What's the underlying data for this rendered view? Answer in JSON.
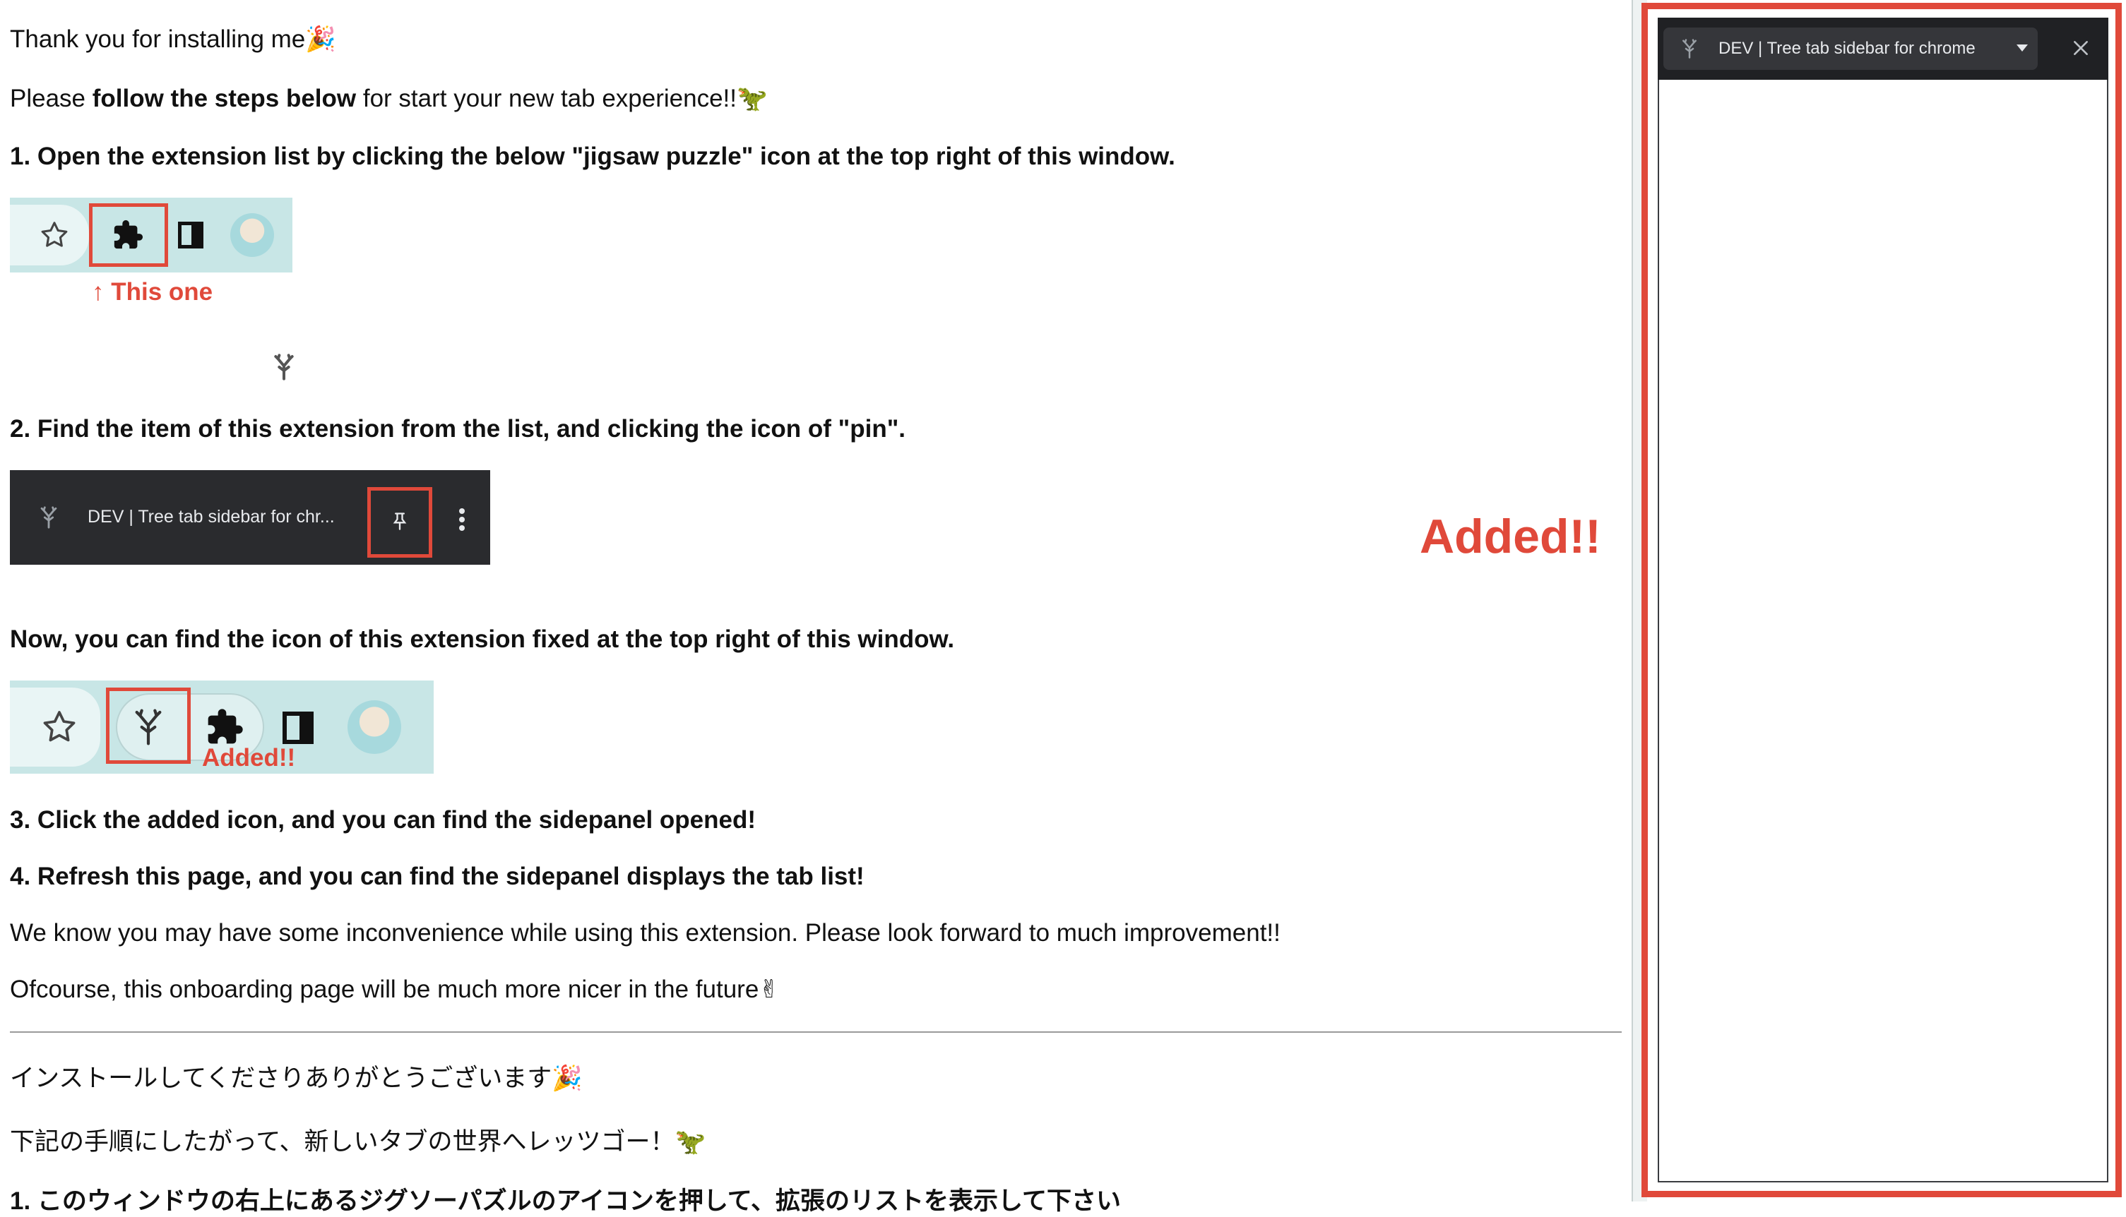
{
  "page": {
    "p_thanks": {
      "text": "Thank you for installing me",
      "emoji": "🎉"
    },
    "p_follow": {
      "pre": "Please ",
      "bold": "follow the steps below",
      "post": " for start your new tab experience!!",
      "emoji": "🦖"
    },
    "step1": "1. Open the extension list by clicking the below \"jigsaw puzzle\" icon at the top right of this window.",
    "this_one": "↑ This one",
    "step2": "2. Find the item of this extension from the list, and clicking the icon of \"pin\".",
    "popup_item_label": "DEV | Tree tab sidebar for chr...",
    "added_big": "Added!!",
    "now_find": "Now, you can find the icon of this extension fixed at the top right of this window.",
    "added_small": "Added!!",
    "step3": "3. Click the added icon, and you can find the sidepanel opened!",
    "step4": "4. Refresh this page, and you can find the sidepanel displays the tab list!",
    "inconvenience": "We know you may have some inconvenience while using this extension. Please look forward to much improvement!!",
    "ofcourse": {
      "text": "Ofcourse, this onboarding page will be much more nicer in the future",
      "emoji": "✌"
    },
    "jp_thanks": {
      "text": "インストールしてくださりありがとうございます",
      "emoji": "🎉"
    },
    "jp_follow": {
      "text": "下記の手順にしたがって、新しいタブの世界へレッツゴー！",
      "emoji": "🦖"
    },
    "jp_step1": "1. このウィンドウの右上にあるジグソーパズルのアイコンを押して、拡張のリストを表示して下さい"
  },
  "sidepanel": {
    "title": "DEV | Tree tab sidebar for chrome"
  },
  "icons": {
    "star": "star-icon",
    "puzzle": "puzzle-icon",
    "sidepanel": "sidepanel-icon",
    "avatar": "avatar",
    "tree": "tree-icon",
    "pin": "pin-icon",
    "kebab": "more-vert-icon",
    "caret": "caret-down-icon",
    "close": "close-icon"
  },
  "colors": {
    "accent_red": "#e0493a",
    "toolbar_bg": "#c8e6e6",
    "popup_bg": "#2a2b2e"
  }
}
